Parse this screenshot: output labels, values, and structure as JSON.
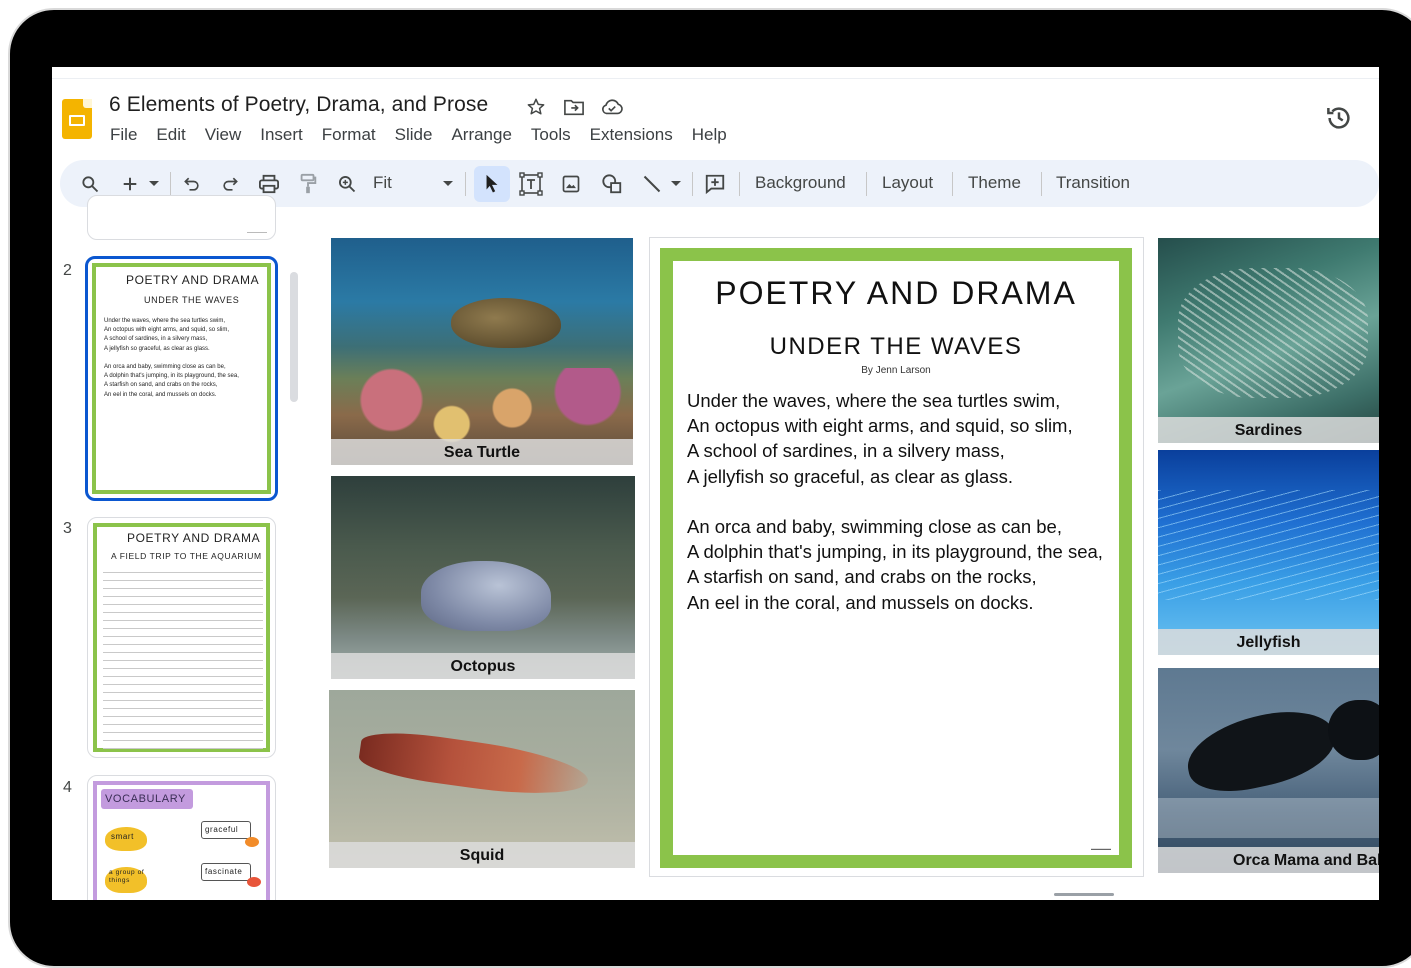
{
  "doc": {
    "title": "6 Elements of Poetry, Drama, and Prose"
  },
  "menu": [
    "File",
    "Edit",
    "View",
    "Insert",
    "Format",
    "Slide",
    "Arrange",
    "Tools",
    "Extensions",
    "Help"
  ],
  "toolbar": {
    "zoom_label": "Fit",
    "background": "Background",
    "layout": "Layout",
    "theme": "Theme",
    "transition": "Transition"
  },
  "filmstrip": {
    "slides": [
      {
        "number": "2",
        "title": "POETRY AND DRAMA",
        "subtitle": "UNDER THE WAVES",
        "lines": [
          "Under the waves, where the sea turtles swim,",
          "An octopus with eight arms, and squid, so slim,",
          "A school of sardines, in a silvery mass,",
          "A jellyfish so graceful, as clear as glass.",
          "",
          "An orca and baby, swimming close as can be,",
          "A dolphin that's jumping, in its playground, the sea,",
          "A starfish on sand, and crabs on the rocks,",
          "An eel in the coral, and mussels on docks."
        ]
      },
      {
        "number": "3",
        "title": "POETRY AND DRAMA",
        "subtitle": "A FIELD TRIP TO THE AQUARIUM"
      },
      {
        "number": "4",
        "title": "VOCABULARY",
        "words": [
          "smart",
          "graceful",
          "a group of things",
          "fascinate"
        ]
      }
    ]
  },
  "slide": {
    "title": "POETRY AND DRAMA",
    "subtitle": "UNDER THE WAVES",
    "author": "By Jenn Larson",
    "stanza1": [
      "Under the waves, where the sea turtles swim,",
      "An octopus with eight arms, and squid, so slim,",
      "A school of sardines, in a silvery mass,",
      "A jellyfish so graceful, as clear as glass."
    ],
    "stanza2": [
      "An orca and baby, swimming close as can be,",
      "A dolphin that's jumping, in its playground, the sea,",
      "A starfish on sand, and crabs on the rocks,",
      "An eel in the coral, and mussels on docks."
    ],
    "photos": {
      "sea_turtle": "Sea Turtle",
      "octopus": "Octopus",
      "squid": "Squid",
      "sardines": "Sardines",
      "jellyfish": "Jellyfish",
      "orca": "Orca Mama and Bab"
    }
  },
  "colors": {
    "accent_blue": "#0b57d0",
    "frame_green": "#8bc34a",
    "toolbar_bg": "#edf2fa",
    "slides_yellow": "#f4b400"
  }
}
